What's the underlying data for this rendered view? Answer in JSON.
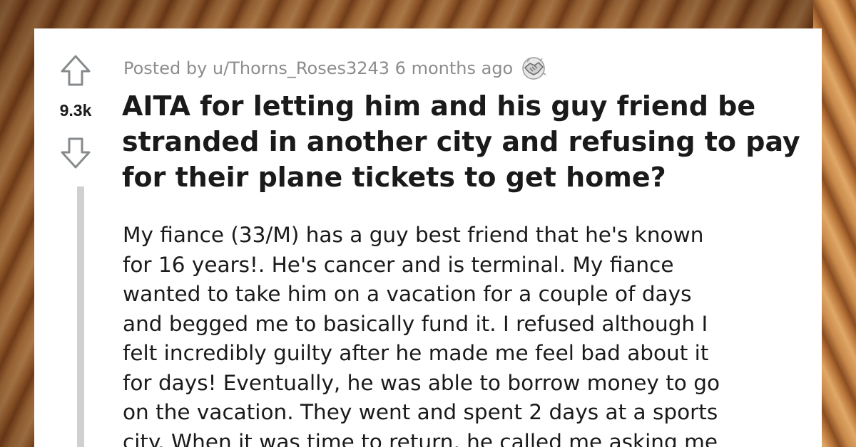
{
  "post": {
    "score": "9.3k",
    "meta": "Posted by u/Thorns_Roses3243 6 months ago",
    "award_icon": "handshake-award-icon",
    "title": "AITA for letting him and his guy friend be stranded in another city and refusing to pay for their plane tickets to get home?",
    "body": "My fiance (33/M) has a guy best friend that he's known\nfor 16 years!. He's cancer and is terminal. My fiance\nwanted to take him on a vacation for a couple of days\nand begged me to basically fund it. I refused although I\nfelt incredibly guilty after he made me feel bad about it\nfor days! Eventually, he was able to borrow money to go\non the vacation. They went and spent 2 days at a sports\ncity. When it was time to return, he called me asking me"
  },
  "icons": {
    "upvote": "upvote-arrow-icon",
    "downvote": "downvote-arrow-icon"
  },
  "colors": {
    "text": "#1a1a1b",
    "meta": "#8c8c8c",
    "thread_line": "#d0d0d0",
    "card": "#ffffff"
  }
}
